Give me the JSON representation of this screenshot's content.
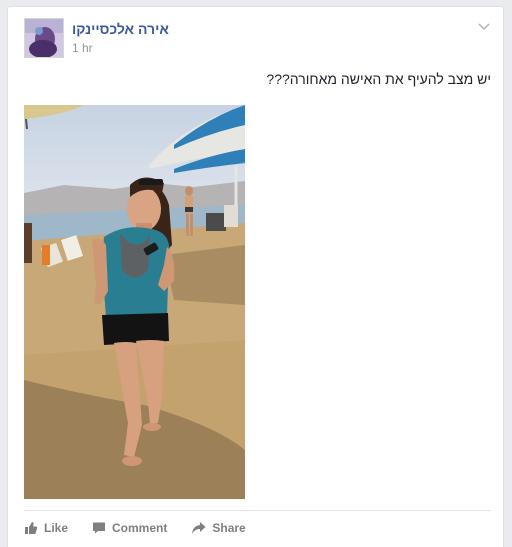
{
  "post": {
    "author": "אירה אלכסיינקו",
    "time": "1 hr",
    "text": "יש מצב להעיף את האישה מאחורה???"
  },
  "actions": {
    "like": "Like",
    "comment": "Comment",
    "share": "Share"
  },
  "icons": {
    "menu": "chevron-down-icon",
    "like": "thumbs-up-icon",
    "comment": "speech-bubble-icon",
    "share": "share-arrow-icon"
  },
  "colors": {
    "author": "#3b5998",
    "action": "#7f7f7f",
    "background": "#e9ebee"
  }
}
